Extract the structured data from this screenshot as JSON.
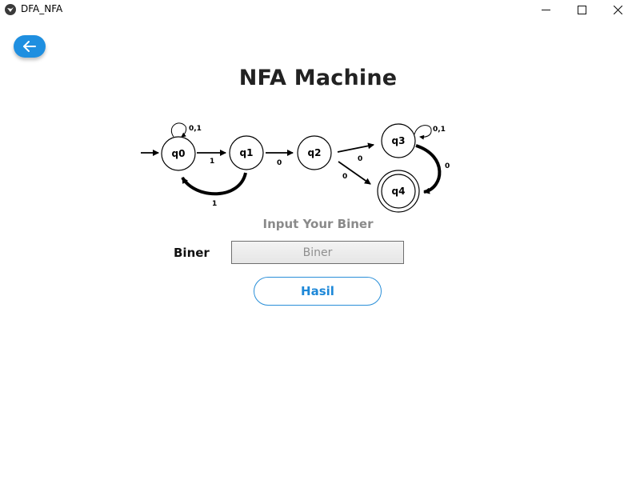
{
  "window": {
    "title": "DFA_NFA"
  },
  "page": {
    "title": "NFA Machine",
    "subtitle": "Input Your Biner"
  },
  "diagram": {
    "states": [
      "q0",
      "q1",
      "q2",
      "q3",
      "q4"
    ],
    "accept_state": "q4",
    "transitions": [
      {
        "from": "q0",
        "to": "q0",
        "label": "0,1"
      },
      {
        "from": "q0",
        "to": "q1",
        "label": "1"
      },
      {
        "from": "q1",
        "to": "q0",
        "label": "1"
      },
      {
        "from": "q1",
        "to": "q2",
        "label": "0"
      },
      {
        "from": "q2",
        "to": "q3",
        "label": "0"
      },
      {
        "from": "q2",
        "to": "q4",
        "label": "0"
      },
      {
        "from": "q3",
        "to": "q3",
        "label": "0,1"
      },
      {
        "from": "q3",
        "to": "q4",
        "label": "0"
      }
    ]
  },
  "form": {
    "biner_label": "Biner",
    "biner_placeholder": "Biner",
    "biner_value": "",
    "submit_label": "Hasil"
  },
  "colors": {
    "accent": "#1f8fe0",
    "subtitle": "#8a8a8a"
  }
}
